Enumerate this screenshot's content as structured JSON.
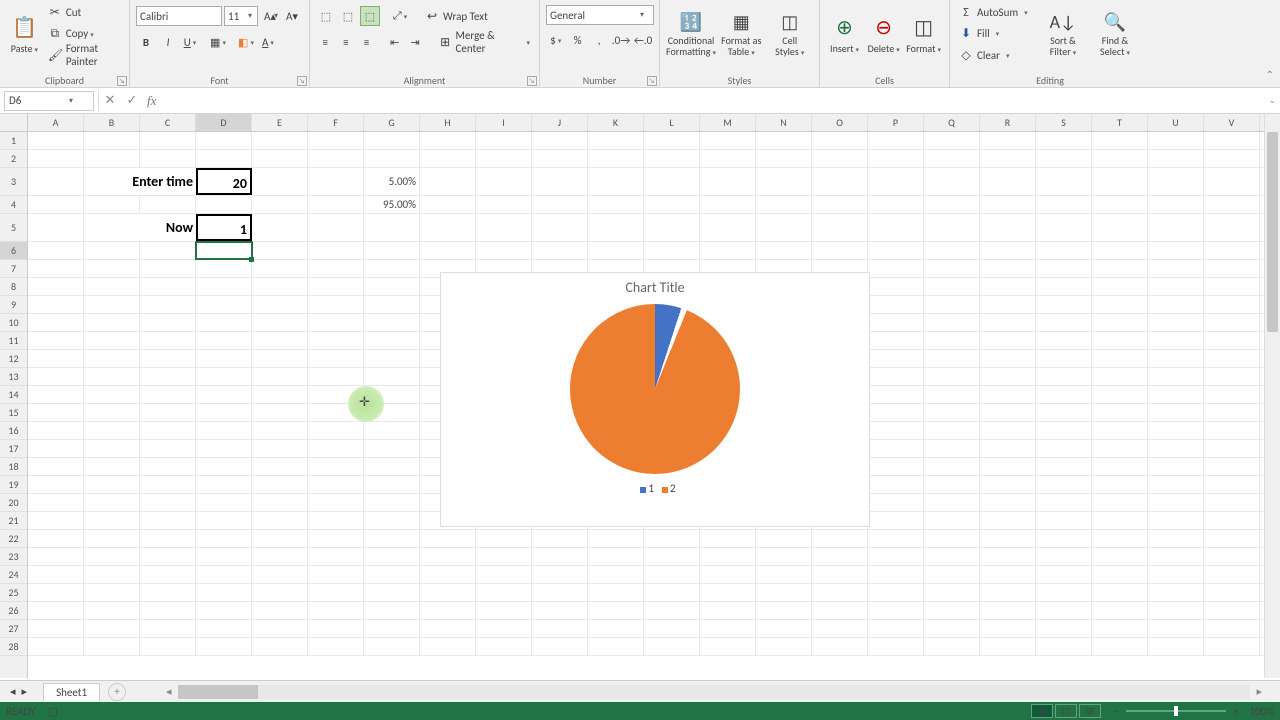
{
  "ribbon": {
    "clipboard": {
      "label": "Clipboard",
      "paste": "Paste",
      "cut": "Cut",
      "copy": "Copy",
      "format_painter": "Format Painter"
    },
    "font": {
      "label": "Font",
      "name": "Calibri",
      "size": "11"
    },
    "alignment": {
      "label": "Alignment",
      "wrap": "Wrap Text",
      "merge": "Merge & Center"
    },
    "number": {
      "label": "Number",
      "format": "General"
    },
    "styles": {
      "label": "Styles",
      "cond": "Conditional\nFormatting",
      "table": "Format as\nTable",
      "cell": "Cell\nStyles"
    },
    "cells": {
      "label": "Cells",
      "insert": "Insert",
      "delete": "Delete",
      "format": "Format"
    },
    "editing": {
      "label": "Editing",
      "autosum": "AutoSum",
      "fill": "Fill",
      "clear": "Clear",
      "sort": "Sort &\nFilter",
      "find": "Find &\nSelect"
    }
  },
  "namebox": "D6",
  "formula": "",
  "columns": [
    "A",
    "B",
    "C",
    "D",
    "E",
    "F",
    "G",
    "H",
    "I",
    "J",
    "K",
    "L",
    "M",
    "N",
    "O",
    "P",
    "Q",
    "R",
    "S",
    "T",
    "U",
    "V"
  ],
  "active_col": "D",
  "active_row": 6,
  "rows": [
    1,
    2,
    3,
    4,
    5,
    6,
    7,
    8,
    9,
    10,
    11,
    12,
    13,
    14,
    15,
    16,
    17,
    18,
    19,
    20,
    21,
    22,
    23,
    24,
    25,
    26,
    27,
    28
  ],
  "tall_rows": [
    3,
    5
  ],
  "cells": {
    "C3": "Enter time",
    "D3": "20",
    "G3": "5.00%",
    "G4": "95.00%",
    "C5": "Now",
    "D5": "1"
  },
  "chart_data": {
    "type": "pie",
    "title": "Chart Title",
    "categories": [
      "1",
      "2"
    ],
    "values": [
      5.0,
      95.0
    ],
    "colors": [
      "#4472c4",
      "#ed7d31"
    ],
    "legend_position": "bottom"
  },
  "sheet_tab": "Sheet1",
  "status": {
    "ready": "READY",
    "zoom": "100%"
  }
}
